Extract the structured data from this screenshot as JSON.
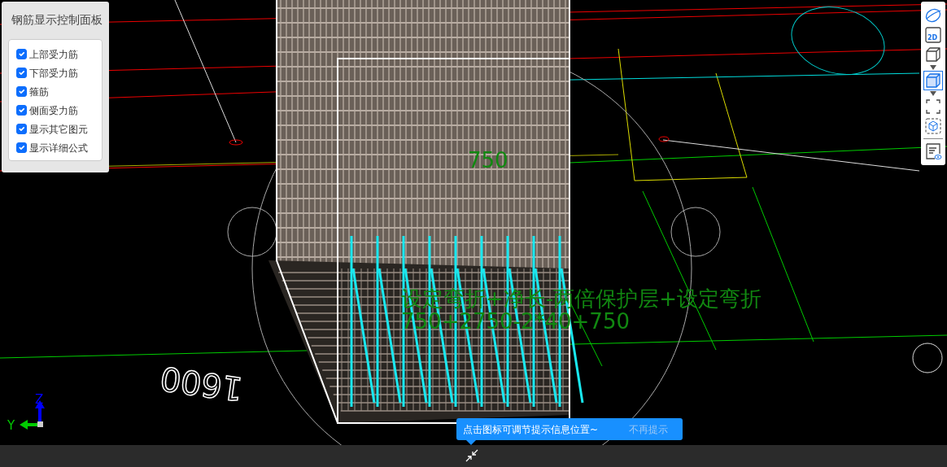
{
  "panel": {
    "title": "钢筋显示控制面板",
    "options": [
      {
        "label": "上部受力筋",
        "checked": true
      },
      {
        "label": "下部受力筋",
        "checked": true
      },
      {
        "label": "箍筋",
        "checked": true
      },
      {
        "label": "侧面受力筋",
        "checked": true
      },
      {
        "label": "显示其它图元",
        "checked": true
      },
      {
        "label": "显示详细公式",
        "checked": true
      }
    ]
  },
  "canvas": {
    "dimension_label": "750",
    "formula": [
      "设定弯折+净长-两倍保护层+设定弯折",
      "750+2750-2*40+750"
    ],
    "mirrored_label": "1600",
    "axis": {
      "z": "Z",
      "y": "Y"
    }
  },
  "toolbar": {
    "items": [
      {
        "kind": "orbit",
        "selected": false
      },
      {
        "kind": "view-2d",
        "label": "2D",
        "selected": false
      },
      {
        "kind": "cube",
        "selected": false,
        "dropdown": true
      },
      {
        "kind": "cube",
        "selected": true,
        "dropdown": true
      },
      {
        "kind": "frame",
        "selected": false
      },
      {
        "kind": "box-cube",
        "selected": false
      },
      {
        "kind": "divider"
      },
      {
        "kind": "properties",
        "selected": false
      }
    ]
  },
  "tip": {
    "message": "点击图标可调节提示信息位置~",
    "dismiss": "不再提示"
  }
}
